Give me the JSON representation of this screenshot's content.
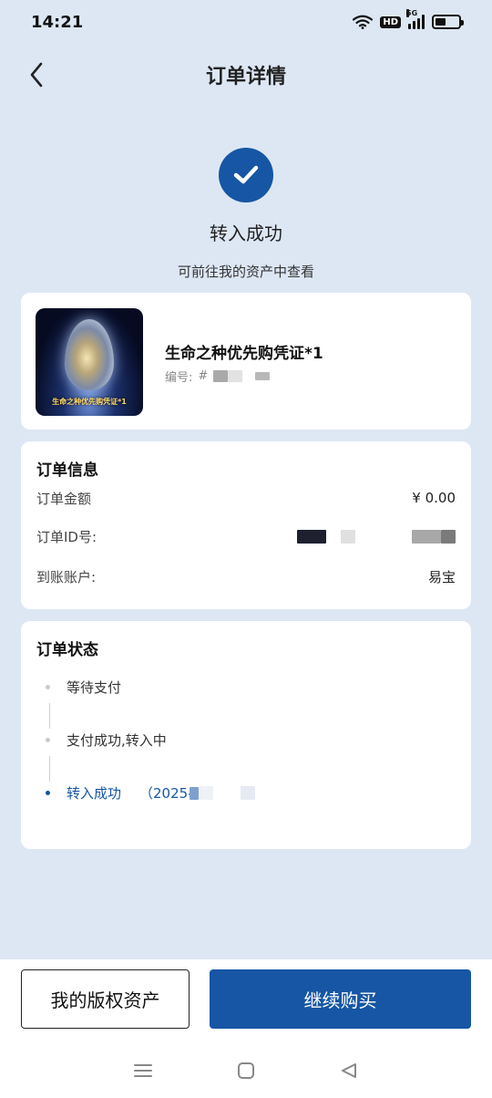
{
  "status_bar": {
    "time": "14:21",
    "hd": "HD",
    "network": "5G"
  },
  "nav": {
    "title": "订单详情"
  },
  "result": {
    "title": "转入成功",
    "subtitle": "可前往我的资产中查看"
  },
  "product": {
    "name": "生命之种优先购凭证*1",
    "serial_label": "编号:",
    "serial_prefix": "#",
    "image_caption": "生命之种优先购凭证*1"
  },
  "order_info": {
    "title": "订单信息",
    "rows": [
      {
        "label": "订单金额",
        "value": "¥ 0.00"
      },
      {
        "label": "订单ID号:",
        "value": ""
      },
      {
        "label": "到账账户:",
        "value": "易宝"
      }
    ]
  },
  "order_status": {
    "title": "订单状态",
    "steps": [
      {
        "label": "等待支付",
        "active": false
      },
      {
        "label": "支付成功,转入中",
        "active": false
      },
      {
        "label": "转入成功",
        "time": "（2025-",
        "active": true
      }
    ]
  },
  "actions": {
    "secondary": "我的版权资产",
    "primary": "继续购买"
  },
  "colors": {
    "accent": "#1656a4",
    "background": "#dde7f4"
  }
}
